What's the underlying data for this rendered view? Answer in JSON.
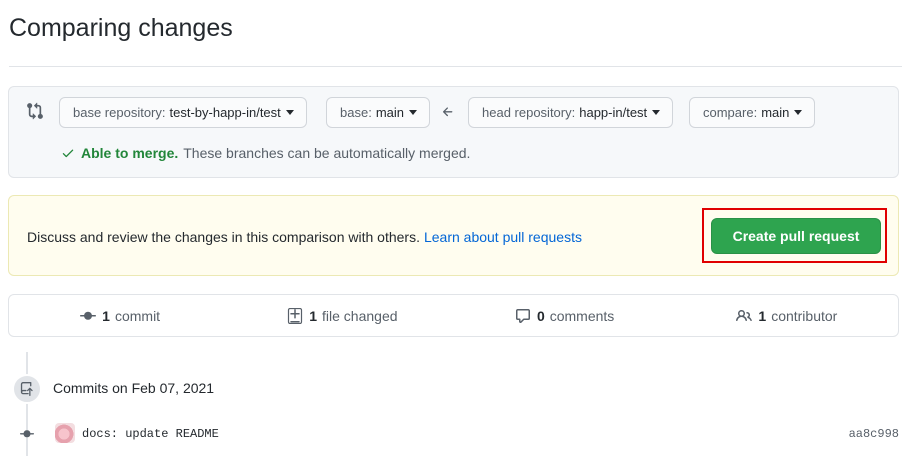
{
  "page": {
    "title": "Comparing changes"
  },
  "range": {
    "base_repo": {
      "label": "base repository:",
      "value": "test-by-happ-in/test"
    },
    "base": {
      "label": "base:",
      "value": "main"
    },
    "head_repo": {
      "label": "head repository:",
      "value": "happ-in/test"
    },
    "compare": {
      "label": "compare:",
      "value": "main"
    },
    "merge": {
      "status": "Able to merge.",
      "description": "These branches can be automatically merged."
    }
  },
  "callout": {
    "text": "Discuss and review the changes in this comparison with others.",
    "link": "Learn about pull requests",
    "button": "Create pull request"
  },
  "summary": {
    "commits": {
      "count": "1",
      "label": "commit"
    },
    "files": {
      "count": "1",
      "label": "file changed"
    },
    "comments": {
      "count": "0",
      "label": "comments"
    },
    "contributors": {
      "count": "1",
      "label": "contributor"
    }
  },
  "commits_group": {
    "date": "Commits on Feb 07, 2021",
    "items": [
      {
        "message": "docs: update README",
        "sha": "aa8c998"
      }
    ]
  },
  "colors": {
    "accent_green": "#2ea44f",
    "link_blue": "#0366d6",
    "highlight_red": "#e00000",
    "callout_bg": "#fffdef"
  }
}
